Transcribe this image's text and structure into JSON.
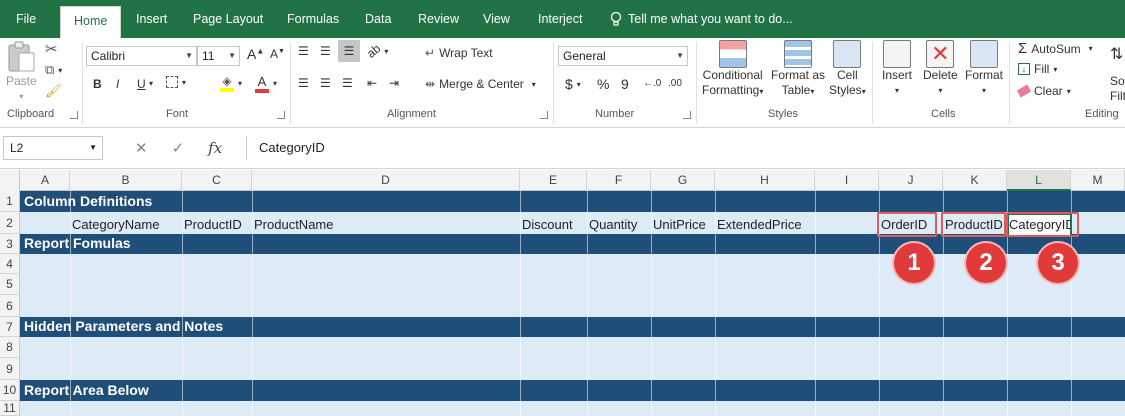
{
  "ribbon_tabs": [
    "File",
    "Home",
    "Insert",
    "Page Layout",
    "Formulas",
    "Data",
    "Review",
    "View",
    "Interject"
  ],
  "tell_me": "Tell me what you want to do...",
  "clipboard": {
    "paste": "Paste",
    "group": "Clipboard"
  },
  "font": {
    "name": "Calibri",
    "size": "11",
    "group": "Font",
    "bold": "B",
    "italic": "I",
    "underline": "U"
  },
  "alignment": {
    "wrap_text": "Wrap Text",
    "merge_center": "Merge & Center",
    "group": "Alignment"
  },
  "number": {
    "format": "General",
    "currency": "$",
    "percent": "%",
    "comma": "9",
    "group": "Number"
  },
  "styles": {
    "conditional": "Conditional",
    "formatting": "Formatting",
    "format_as": "Format as",
    "table": "Table",
    "cell": "Cell",
    "cell_styles": "Styles",
    "group": "Styles"
  },
  "cells": {
    "insert": "Insert",
    "delete": "Delete",
    "format": "Format",
    "group": "Cells"
  },
  "editing": {
    "autosum": "AutoSum",
    "fill": "Fill",
    "clear": "Clear",
    "sort": "So",
    "filter": "Filt",
    "group": "Editing"
  },
  "formula_bar": {
    "name_box": "L2",
    "content": "CategoryID"
  },
  "columns": [
    "A",
    "B",
    "C",
    "D",
    "E",
    "F",
    "G",
    "H",
    "I",
    "J",
    "K",
    "L",
    "M"
  ],
  "selected_column": "L",
  "rows": [
    "1",
    "2",
    "3",
    "4",
    "5",
    "6",
    "7",
    "8",
    "9",
    "10",
    "11"
  ],
  "sections": {
    "col_defs": "Column Definitions",
    "report_formulas": "Report Fomulas",
    "hidden_params": "Hidden Parameters and Notes",
    "report_area": "Report Area Below"
  },
  "row2_cells": {
    "B": "CategoryName",
    "C": "ProductID",
    "D": "ProductName",
    "E": "Discount",
    "F": "Quantity",
    "G": "UnitPrice",
    "H": "ExtendedPrice",
    "J": "OrderID",
    "K": "ProductID",
    "L": "CategoryID"
  },
  "badges": [
    "1",
    "2",
    "3"
  ],
  "colors": {
    "ribbon_green": "#217346",
    "section_dark": "#1f4e78",
    "section_light": "#ddebf7",
    "annotation_red": "#e03a3a"
  }
}
